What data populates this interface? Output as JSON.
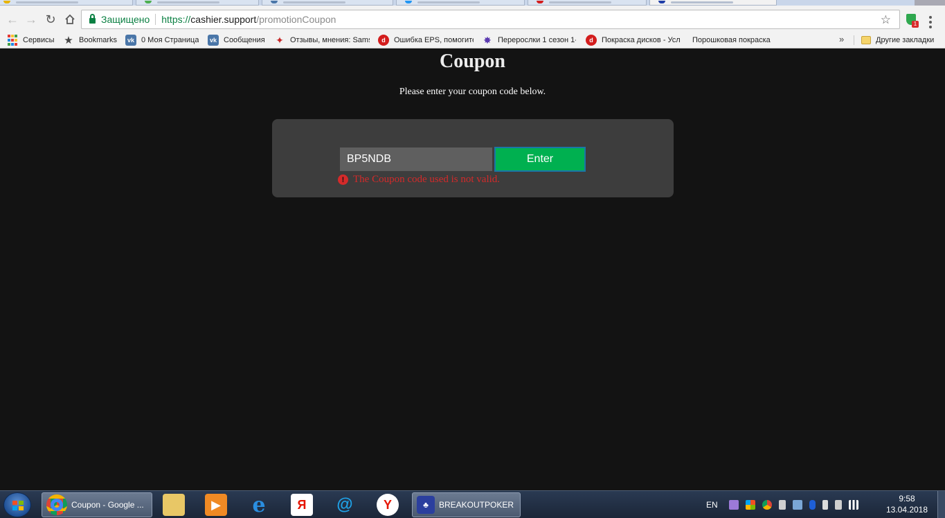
{
  "browser": {
    "secure_label": "Защищено",
    "url_scheme": "https://",
    "url_host": "cashier.support",
    "url_path": "/promotionCoupon",
    "extension_badge_count": "1"
  },
  "bookmarks": {
    "items": [
      {
        "label": "Сервисы",
        "icon": "apps-grid-icon"
      },
      {
        "label": "Bookmarks",
        "icon": "star-icon"
      },
      {
        "label": "0 Моя Страница",
        "icon": "vk-icon"
      },
      {
        "label": "Сообщения",
        "icon": "vk-icon"
      },
      {
        "label": "Отзывы, мнения: Sams",
        "icon": "plug-icon"
      },
      {
        "label": "Ошибка EPS, помогите",
        "icon": "drive2-icon"
      },
      {
        "label": "Перерослки 1 сезон 1-",
        "icon": "pinwheel-icon"
      },
      {
        "label": "Покраска дисков - Усл",
        "icon": "drive2-icon"
      },
      {
        "label": "Порошковая покраска",
        "icon": "page-icon"
      }
    ],
    "more_label": "»",
    "other_label": "Другие закладки"
  },
  "page": {
    "title": "Coupon",
    "subtitle": "Please enter your coupon code below.",
    "coupon_value": "BP5NDB",
    "enter_label": "Enter",
    "error_message": "The Coupon code used is not valid.",
    "colors": {
      "background": "#131313",
      "card": "#3d3d3d",
      "button": "#00b050",
      "error": "#d42a2a"
    }
  },
  "taskbar": {
    "chrome_task_label": "Coupon - Google ...",
    "poker_task_label": "BREAKOUTPOKER",
    "pinned": [
      "file-explorer-icon",
      "media-player-icon",
      "internet-explorer-icon",
      "yandex-icon",
      "mail-icon",
      "yandex-browser-icon"
    ],
    "language": "EN",
    "time": "9:58",
    "date": "13.04.2018"
  }
}
